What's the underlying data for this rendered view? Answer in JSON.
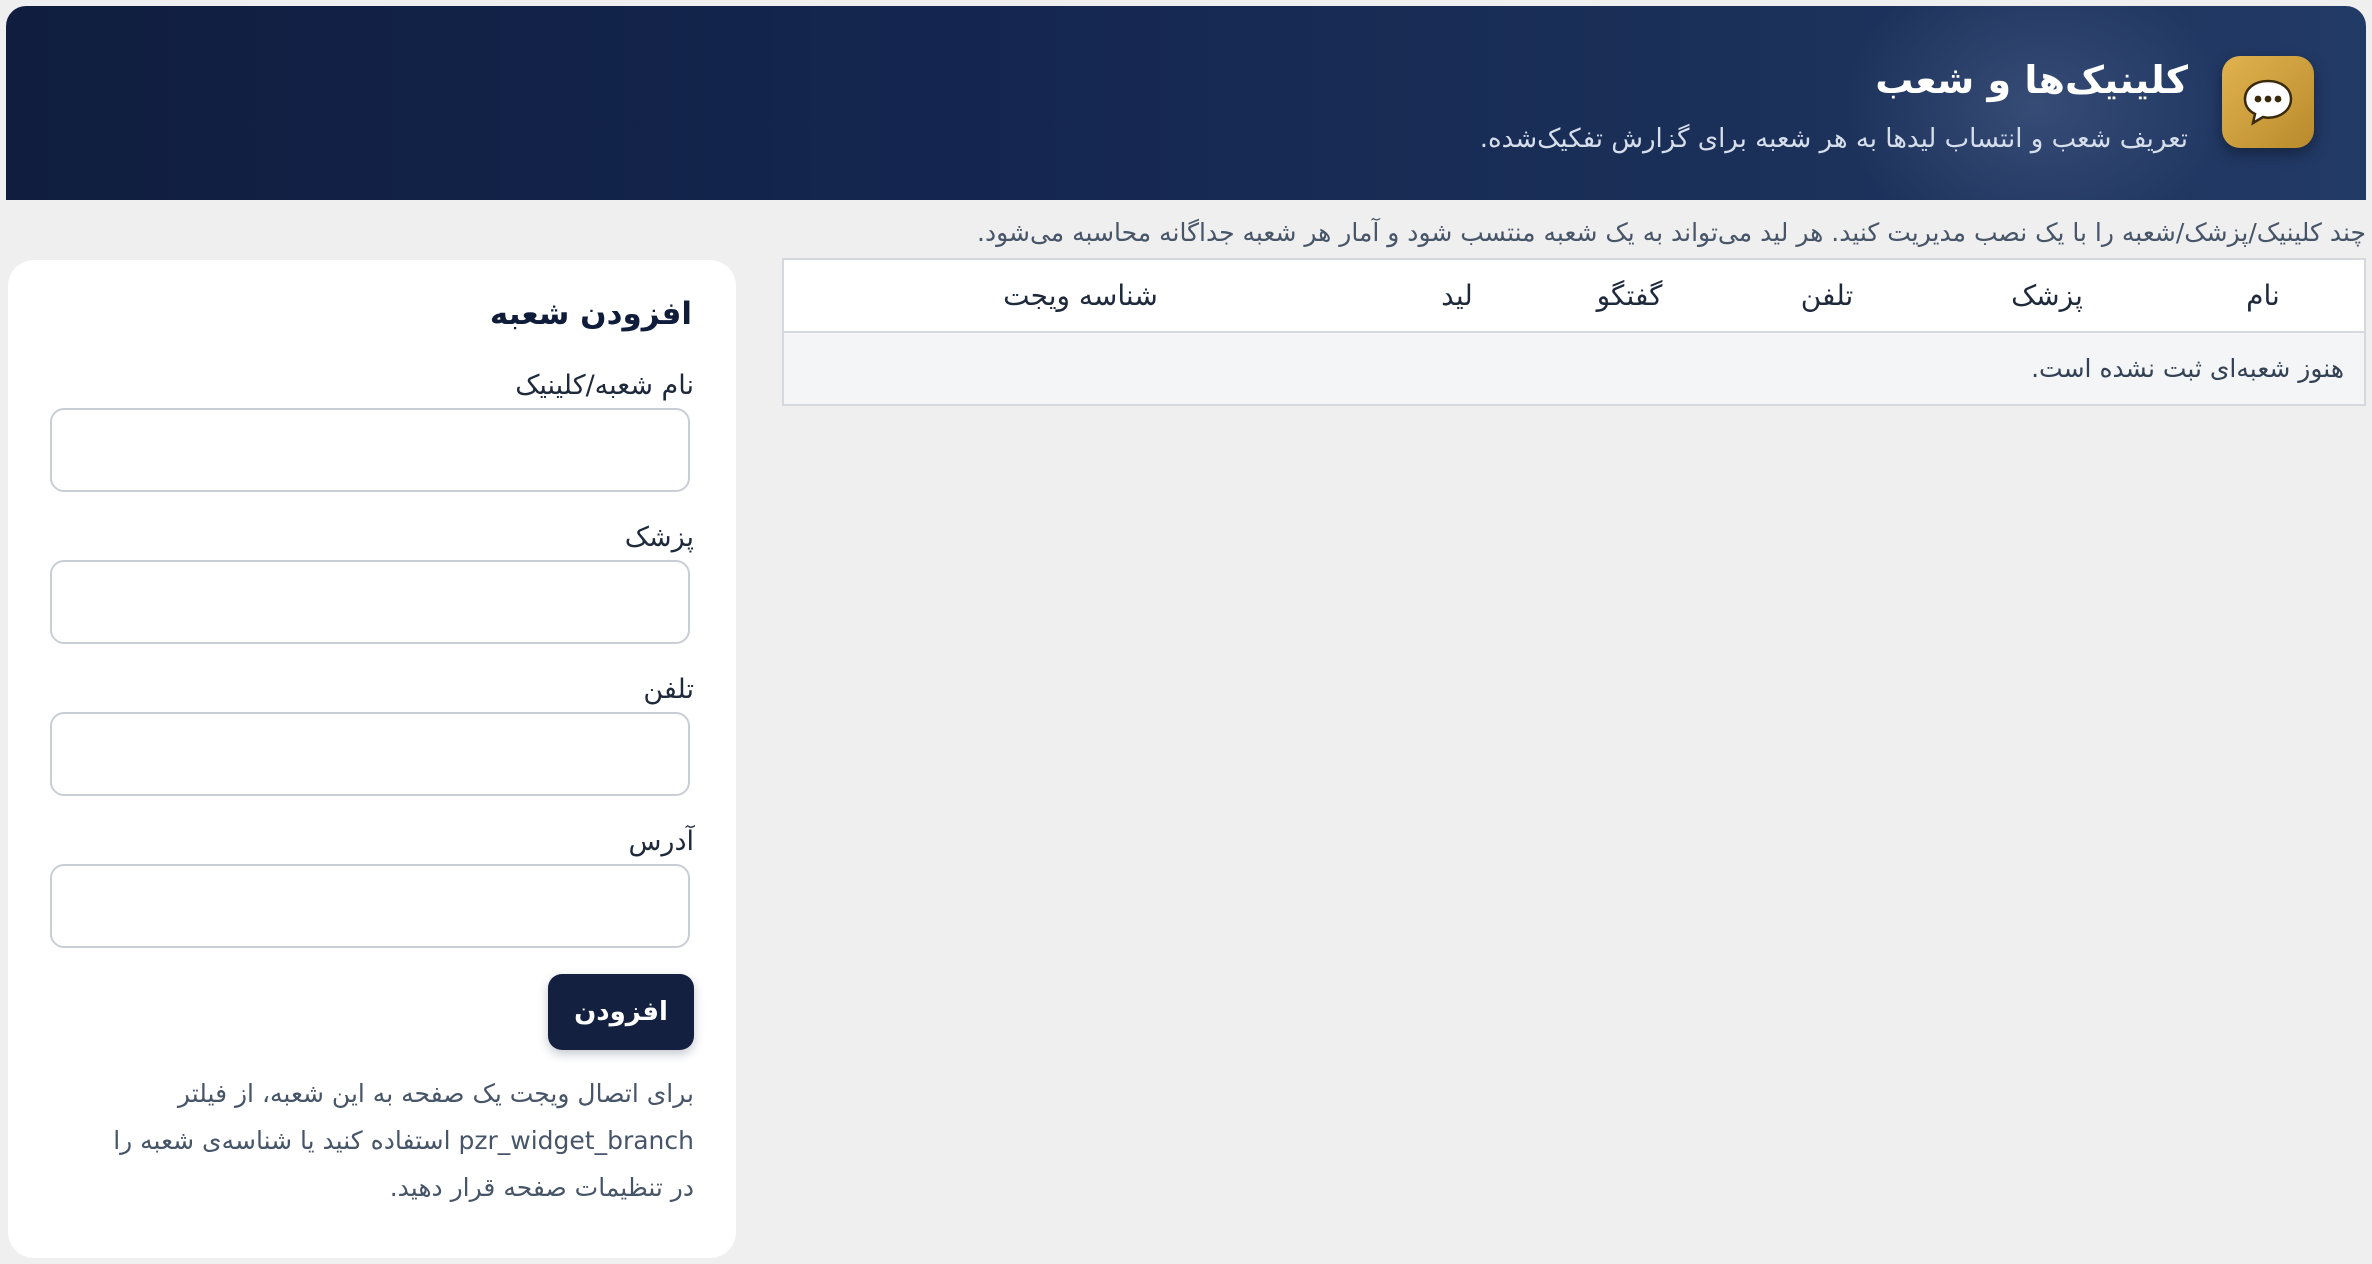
{
  "header": {
    "icon": "chat-bubble-icon",
    "title": "کلینیک‌ها و شعب",
    "subtitle": "تعریف شعب و انتساب لیدها به هر شعبه برای گزارش تفکیک‌شده."
  },
  "intro": "چند کلینیک/پزشک/شعبه را با یک نصب مدیریت کنید. هر لید می‌تواند به یک شعبه منتسب شود و آمار هر شعبه جداگانه محاسبه می‌شود.",
  "table": {
    "columns": [
      "نام",
      "پزشک",
      "تلفن",
      "گفتگو",
      "لید",
      "شناسه ویجت"
    ],
    "empty_message": "هنوز شعبه‌ای ثبت نشده است."
  },
  "form": {
    "title": "افزودن شعبه",
    "fields": [
      {
        "label": "نام شعبه/کلینیک",
        "value": ""
      },
      {
        "label": "پزشک",
        "value": ""
      },
      {
        "label": "تلفن",
        "value": ""
      },
      {
        "label": "آدرس",
        "value": ""
      }
    ],
    "submit_label": "افزودن",
    "help_before": "برای اتصال ویجت یک صفحه به این شعبه، از فیلتر",
    "help_code": "pzr_widget_branch",
    "help_after": "استفاده کنید یا شناسه‌ی شعبه را در تنظیمات صفحه قرار دهید."
  },
  "colors": {
    "header_bg": "#142650",
    "icon_bg": "#d4a441",
    "button_bg": "#13203f"
  }
}
